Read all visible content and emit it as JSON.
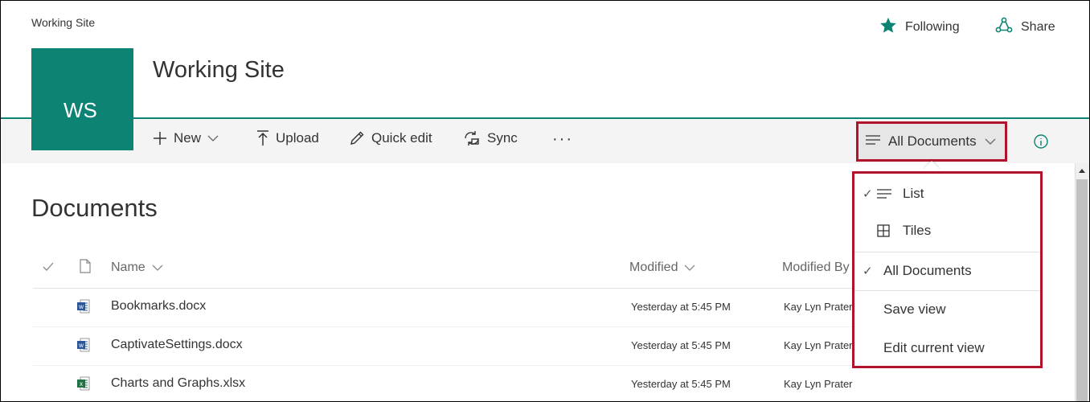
{
  "breadcrumb": "Working Site",
  "header_actions": {
    "following": "Following",
    "share": "Share"
  },
  "site": {
    "logo_initials": "WS",
    "title": "Working Site"
  },
  "commands": {
    "new": "New",
    "upload": "Upload",
    "quick_edit": "Quick edit",
    "sync": "Sync",
    "more": "···"
  },
  "view_switch": {
    "label": "All Documents"
  },
  "view_menu": {
    "items": [
      {
        "label": "List",
        "checked": true,
        "icon": "list-icon"
      },
      {
        "label": "Tiles",
        "checked": false,
        "icon": "tiles-icon"
      },
      {
        "label": "All Documents",
        "checked": true,
        "icon": ""
      },
      {
        "label": "Save view",
        "checked": false,
        "icon": ""
      },
      {
        "label": "Edit current view",
        "checked": false,
        "icon": ""
      }
    ]
  },
  "page_heading": "Documents",
  "columns": {
    "name": "Name",
    "modified": "Modified",
    "modified_by": "Modified By"
  },
  "files": [
    {
      "name": "Bookmarks.docx",
      "type": "word",
      "modified": "Yesterday at 5:45 PM",
      "modified_by": "Kay Lyn Prater"
    },
    {
      "name": "CaptivateSettings.docx",
      "type": "word",
      "modified": "Yesterday at 5:45 PM",
      "modified_by": "Kay Lyn Prater"
    },
    {
      "name": "Charts and Graphs.xlsx",
      "type": "excel",
      "modified": "Yesterday at 5:45 PM",
      "modified_by": "Kay Lyn Prater"
    }
  ],
  "colors": {
    "brand": "#0d8373",
    "highlight": "#b0132b",
    "word": "#2b579a",
    "excel": "#217346"
  }
}
